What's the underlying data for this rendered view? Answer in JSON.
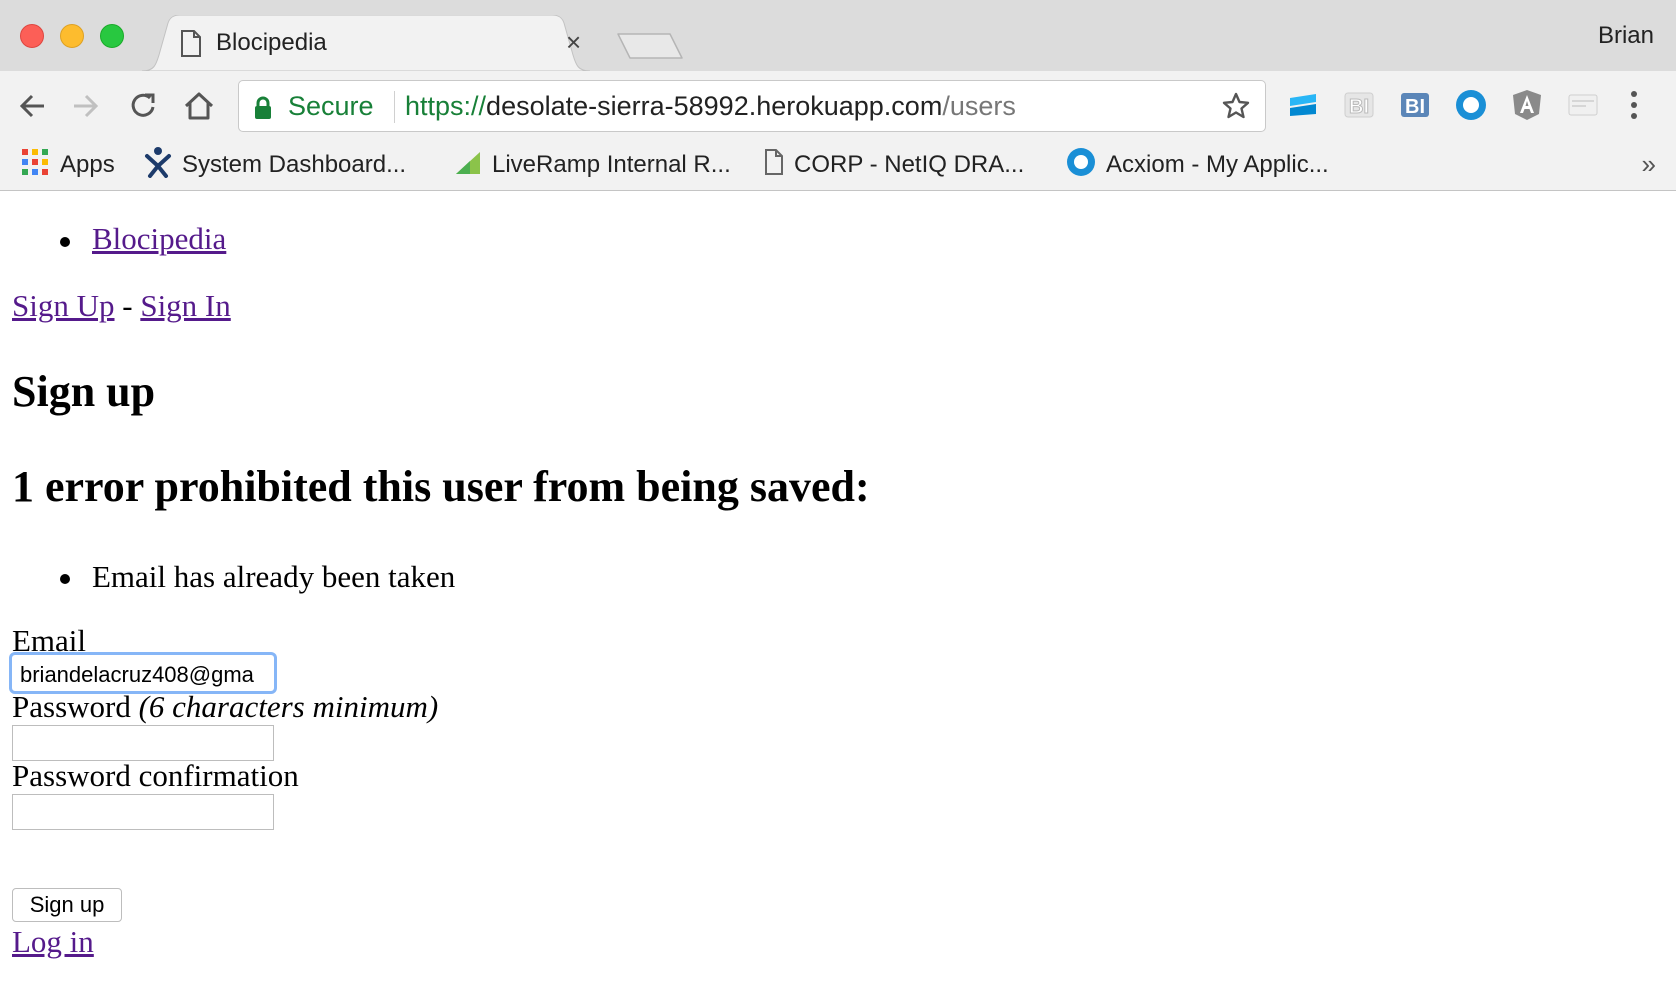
{
  "browser": {
    "tab": {
      "title": "Blocipedia",
      "close_glyph": "×",
      "icon": "document-icon"
    },
    "profile_name": "Brian",
    "omnibox": {
      "secure_label": "Secure",
      "url_scheme": "https://",
      "url_host": "desolate-sierra-58992.herokuapp.com",
      "url_path": "/users"
    },
    "bookmarks": [
      {
        "label": "Apps",
        "icon": "apps-grid-icon"
      },
      {
        "label": "System Dashboard...",
        "icon": "jira-icon"
      },
      {
        "label": "LiveRamp Internal R...",
        "icon": "liveramp-icon"
      },
      {
        "label": "CORP - NetIQ DRA...",
        "icon": "document-icon"
      },
      {
        "label": "Acxiom - My Applic...",
        "icon": "okta-icon"
      }
    ],
    "bookmarks_overflow": "»",
    "colors": {
      "secure_green": "#188038",
      "link_purple": "#551a8b",
      "focus_ring": "#86b6f7"
    }
  },
  "page": {
    "nav": {
      "brand_link": "Blocipedia"
    },
    "auth": {
      "sign_up": "Sign Up",
      "separator": "-",
      "sign_in": "Sign In"
    },
    "heading": "Sign up",
    "error_heading": "1 error prohibited this user from being saved:",
    "errors": [
      "Email has already been taken"
    ],
    "form": {
      "email_label": "Email",
      "email_value": "briandelacruz408@gma",
      "password_label": "Password",
      "password_hint": "(6 characters minimum)",
      "password_confirmation_label": "Password confirmation",
      "submit_label": "Sign up"
    },
    "login_link": "Log in"
  }
}
